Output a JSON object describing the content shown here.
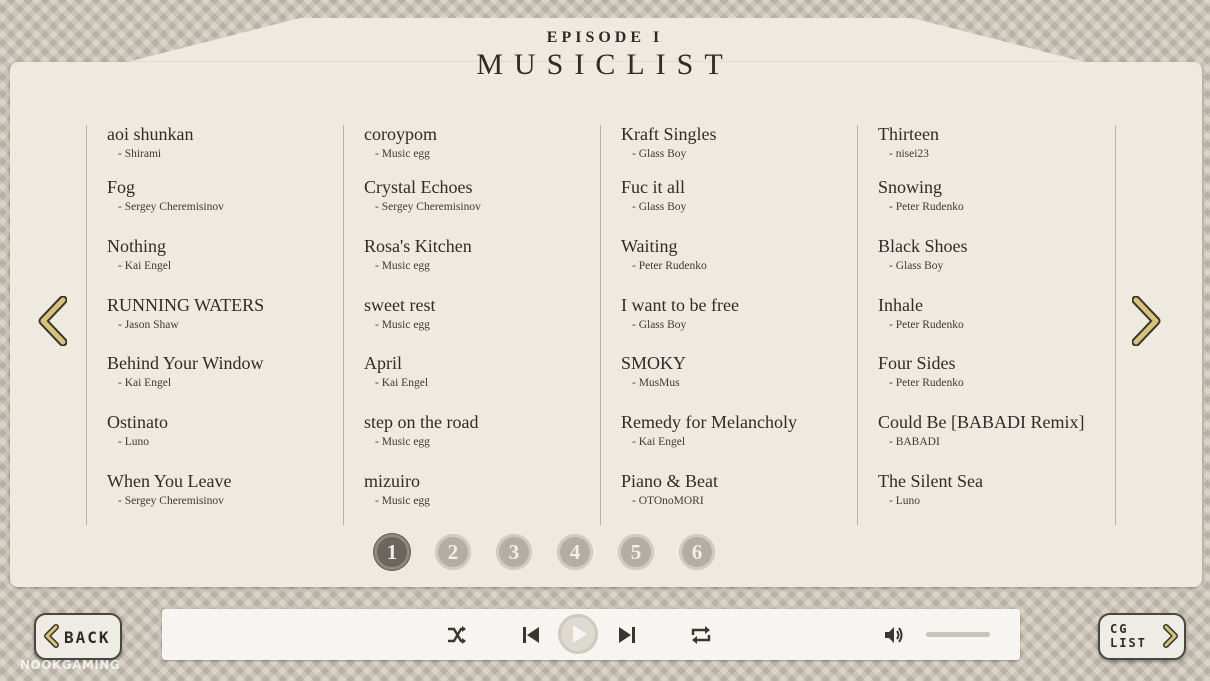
{
  "header": {
    "subtitle": "EPISODE I",
    "title": "MUSICLIST"
  },
  "columns": [
    {
      "tracks": [
        {
          "title": "aoi shunkan",
          "artist": "- Shirami"
        },
        {
          "title": "Fog",
          "artist": "- Sergey Cheremisinov"
        },
        {
          "title": "Nothing",
          "artist": "- Kai Engel"
        },
        {
          "title": "RUNNING WATERS",
          "artist": "- Jason Shaw"
        },
        {
          "title": "Behind Your Window",
          "artist": "- Kai Engel"
        },
        {
          "title": "Ostinato",
          "artist": "- Luno"
        },
        {
          "title": "When You Leave",
          "artist": "- Sergey Cheremisinov"
        }
      ]
    },
    {
      "tracks": [
        {
          "title": "coroypom",
          "artist": "- Music egg"
        },
        {
          "title": "Crystal Echoes",
          "artist": "- Sergey Cheremisinov"
        },
        {
          "title": "Rosa's Kitchen",
          "artist": "- Music egg"
        },
        {
          "title": "sweet rest",
          "artist": "- Music egg"
        },
        {
          "title": "April",
          "artist": "- Kai Engel"
        },
        {
          "title": "step on the road",
          "artist": "- Music egg"
        },
        {
          "title": "mizuiro",
          "artist": "- Music egg"
        }
      ]
    },
    {
      "tracks": [
        {
          "title": "Kraft Singles",
          "artist": "- Glass Boy"
        },
        {
          "title": "Fuc it all",
          "artist": "- Glass Boy"
        },
        {
          "title": "Waiting",
          "artist": "- Peter Rudenko"
        },
        {
          "title": "I want to be free",
          "artist": "- Glass Boy"
        },
        {
          "title": "SMOKY",
          "artist": "- MusMus"
        },
        {
          "title": "Remedy for Melancholy",
          "artist": "- Kai Engel"
        },
        {
          "title": "Piano & Beat",
          "artist": "- OTOnoMORI"
        }
      ]
    },
    {
      "tracks": [
        {
          "title": "Thirteen",
          "artist": "- nisei23"
        },
        {
          "title": "Snowing",
          "artist": "- Peter Rudenko"
        },
        {
          "title": "Black Shoes",
          "artist": "- Glass Boy"
        },
        {
          "title": "Inhale",
          "artist": "- Peter Rudenko"
        },
        {
          "title": "Four Sides",
          "artist": "- Peter Rudenko"
        },
        {
          "title": "Could Be [BABADI Remix]",
          "artist": "- BABADI"
        },
        {
          "title": "The Silent Sea",
          "artist": "- Luno"
        }
      ]
    }
  ],
  "pagination": {
    "pages": [
      "1",
      "2",
      "3",
      "4",
      "5",
      "6"
    ],
    "current": "1"
  },
  "player": {
    "icons": [
      "shuffle-icon",
      "skip-previous-icon",
      "play-icon",
      "skip-next-icon",
      "repeat-icon",
      "volume-icon"
    ],
    "volume": 1.0
  },
  "nav": {
    "back_label": "BACK",
    "cg_label_line1": "CG",
    "cg_label_line2": "LIST"
  },
  "watermark": "NOOKGAMING",
  "colors": {
    "panel": "#efeae0",
    "text": "#2f2c28",
    "active_page": "#6a655d",
    "inactive_page": "#b3aea4",
    "gold_arrow": "#c9b56a"
  }
}
